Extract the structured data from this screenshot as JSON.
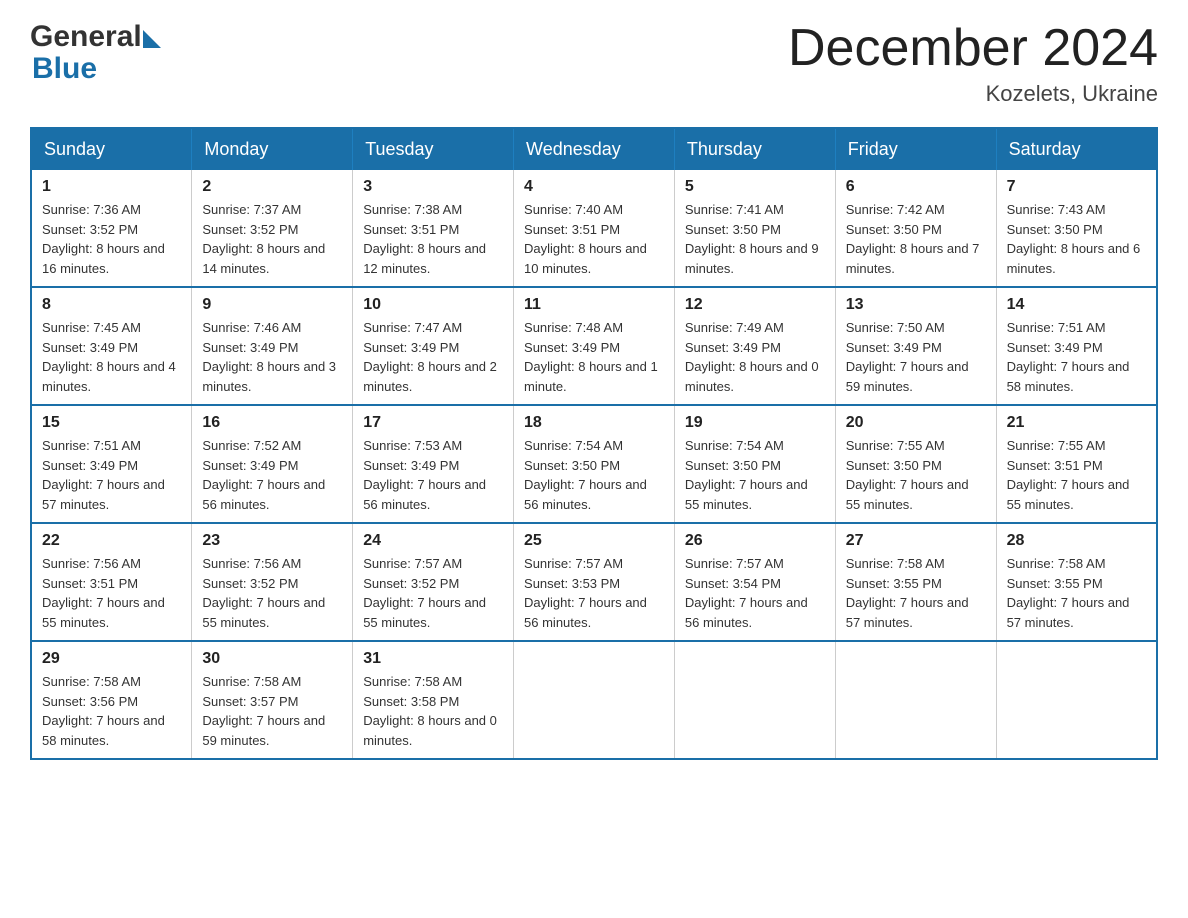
{
  "header": {
    "month_title": "December 2024",
    "location": "Kozelets, Ukraine"
  },
  "logo": {
    "general": "General",
    "blue": "Blue"
  },
  "days_of_week": [
    "Sunday",
    "Monday",
    "Tuesday",
    "Wednesday",
    "Thursday",
    "Friday",
    "Saturday"
  ],
  "weeks": [
    [
      {
        "day": "1",
        "sunrise": "7:36 AM",
        "sunset": "3:52 PM",
        "daylight": "8 hours and 16 minutes."
      },
      {
        "day": "2",
        "sunrise": "7:37 AM",
        "sunset": "3:52 PM",
        "daylight": "8 hours and 14 minutes."
      },
      {
        "day": "3",
        "sunrise": "7:38 AM",
        "sunset": "3:51 PM",
        "daylight": "8 hours and 12 minutes."
      },
      {
        "day": "4",
        "sunrise": "7:40 AM",
        "sunset": "3:51 PM",
        "daylight": "8 hours and 10 minutes."
      },
      {
        "day": "5",
        "sunrise": "7:41 AM",
        "sunset": "3:50 PM",
        "daylight": "8 hours and 9 minutes."
      },
      {
        "day": "6",
        "sunrise": "7:42 AM",
        "sunset": "3:50 PM",
        "daylight": "8 hours and 7 minutes."
      },
      {
        "day": "7",
        "sunrise": "7:43 AM",
        "sunset": "3:50 PM",
        "daylight": "8 hours and 6 minutes."
      }
    ],
    [
      {
        "day": "8",
        "sunrise": "7:45 AM",
        "sunset": "3:49 PM",
        "daylight": "8 hours and 4 minutes."
      },
      {
        "day": "9",
        "sunrise": "7:46 AM",
        "sunset": "3:49 PM",
        "daylight": "8 hours and 3 minutes."
      },
      {
        "day": "10",
        "sunrise": "7:47 AM",
        "sunset": "3:49 PM",
        "daylight": "8 hours and 2 minutes."
      },
      {
        "day": "11",
        "sunrise": "7:48 AM",
        "sunset": "3:49 PM",
        "daylight": "8 hours and 1 minute."
      },
      {
        "day": "12",
        "sunrise": "7:49 AM",
        "sunset": "3:49 PM",
        "daylight": "8 hours and 0 minutes."
      },
      {
        "day": "13",
        "sunrise": "7:50 AM",
        "sunset": "3:49 PM",
        "daylight": "7 hours and 59 minutes."
      },
      {
        "day": "14",
        "sunrise": "7:51 AM",
        "sunset": "3:49 PM",
        "daylight": "7 hours and 58 minutes."
      }
    ],
    [
      {
        "day": "15",
        "sunrise": "7:51 AM",
        "sunset": "3:49 PM",
        "daylight": "7 hours and 57 minutes."
      },
      {
        "day": "16",
        "sunrise": "7:52 AM",
        "sunset": "3:49 PM",
        "daylight": "7 hours and 56 minutes."
      },
      {
        "day": "17",
        "sunrise": "7:53 AM",
        "sunset": "3:49 PM",
        "daylight": "7 hours and 56 minutes."
      },
      {
        "day": "18",
        "sunrise": "7:54 AM",
        "sunset": "3:50 PM",
        "daylight": "7 hours and 56 minutes."
      },
      {
        "day": "19",
        "sunrise": "7:54 AM",
        "sunset": "3:50 PM",
        "daylight": "7 hours and 55 minutes."
      },
      {
        "day": "20",
        "sunrise": "7:55 AM",
        "sunset": "3:50 PM",
        "daylight": "7 hours and 55 minutes."
      },
      {
        "day": "21",
        "sunrise": "7:55 AM",
        "sunset": "3:51 PM",
        "daylight": "7 hours and 55 minutes."
      }
    ],
    [
      {
        "day": "22",
        "sunrise": "7:56 AM",
        "sunset": "3:51 PM",
        "daylight": "7 hours and 55 minutes."
      },
      {
        "day": "23",
        "sunrise": "7:56 AM",
        "sunset": "3:52 PM",
        "daylight": "7 hours and 55 minutes."
      },
      {
        "day": "24",
        "sunrise": "7:57 AM",
        "sunset": "3:52 PM",
        "daylight": "7 hours and 55 minutes."
      },
      {
        "day": "25",
        "sunrise": "7:57 AM",
        "sunset": "3:53 PM",
        "daylight": "7 hours and 56 minutes."
      },
      {
        "day": "26",
        "sunrise": "7:57 AM",
        "sunset": "3:54 PM",
        "daylight": "7 hours and 56 minutes."
      },
      {
        "day": "27",
        "sunrise": "7:58 AM",
        "sunset": "3:55 PM",
        "daylight": "7 hours and 57 minutes."
      },
      {
        "day": "28",
        "sunrise": "7:58 AM",
        "sunset": "3:55 PM",
        "daylight": "7 hours and 57 minutes."
      }
    ],
    [
      {
        "day": "29",
        "sunrise": "7:58 AM",
        "sunset": "3:56 PM",
        "daylight": "7 hours and 58 minutes."
      },
      {
        "day": "30",
        "sunrise": "7:58 AM",
        "sunset": "3:57 PM",
        "daylight": "7 hours and 59 minutes."
      },
      {
        "day": "31",
        "sunrise": "7:58 AM",
        "sunset": "3:58 PM",
        "daylight": "8 hours and 0 minutes."
      },
      null,
      null,
      null,
      null
    ]
  ]
}
